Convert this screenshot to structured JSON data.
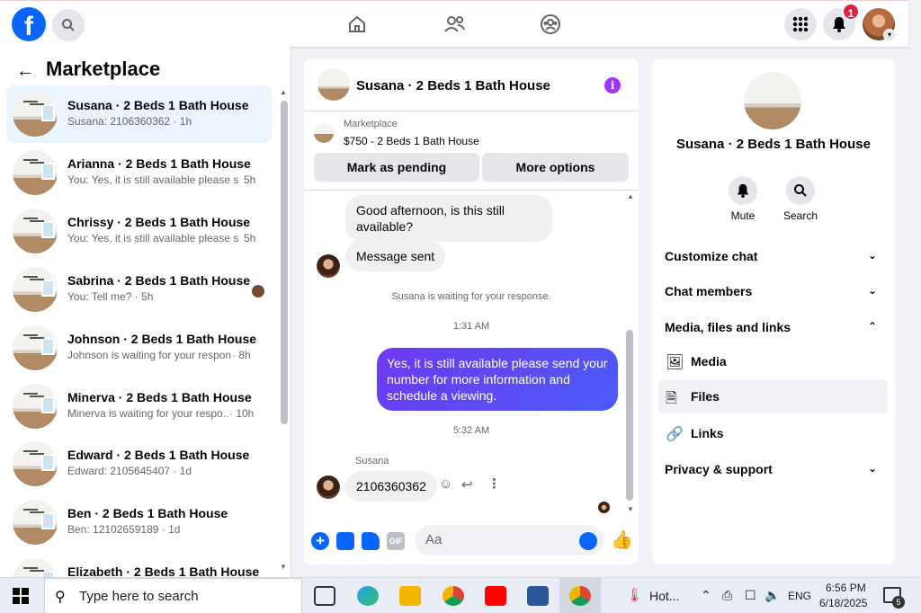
{
  "topbar": {
    "logo": "f",
    "notification_count": "1"
  },
  "left": {
    "title": "Marketplace",
    "conversations": [
      {
        "name": "Susana · 2 Beds 1 Bath House",
        "preview": "Susana: 2106360362 · 1h",
        "time": ""
      },
      {
        "name": "Arianna · 2 Beds 1 Bath House",
        "preview": "You: Yes, it is still available please s...",
        "time": "5h"
      },
      {
        "name": "Chrissy · 2 Beds 1 Bath House",
        "preview": "You: Yes, it is still available please s...",
        "time": "5h"
      },
      {
        "name": "Sabrina · 2 Beds 1 Bath House",
        "preview": "You: Tell me? · 5h",
        "time": ""
      },
      {
        "name": "Johnson · 2 Beds 1 Bath House",
        "preview": "Johnson is waiting for your respon...",
        "time": "· 8h"
      },
      {
        "name": "Minerva · 2 Beds 1 Bath House",
        "preview": "Minerva is waiting for your respo...",
        "time": "· 10h"
      },
      {
        "name": "Edward · 2 Beds 1 Bath House",
        "preview": "Edward: 2105645407 · 1d",
        "time": ""
      },
      {
        "name": "Ben · 2 Beds 1 Bath House",
        "preview": "Ben: 12102659189 · 1d",
        "time": ""
      },
      {
        "name": "Elizabeth · 2 Beds 1 Bath House",
        "preview": "",
        "time": ""
      }
    ]
  },
  "chat": {
    "title": "Susana · 2 Beds 1 Bath House",
    "marketplace_label": "Marketplace",
    "listing": "$750 - 2 Beds 1 Bath House",
    "btn_pending": "Mark as pending",
    "btn_more": "More options",
    "msg1": "Good afternoon, is this still available?",
    "msg2": "Message sent",
    "system": "Susana is waiting for your response.",
    "time1": "1:31 AM",
    "msg3": "Yes, it is still available please send your number for more information and schedule a viewing.",
    "time2": "5:32 AM",
    "sender": "Susana",
    "msg4": "2106360362",
    "composer_placeholder": "Aa"
  },
  "right": {
    "title": "Susana · 2 Beds 1 Bath House",
    "mute": "Mute",
    "search": "Search",
    "customize": "Customize chat",
    "members": "Chat members",
    "media_files": "Media, files and links",
    "media": "Media",
    "files": "Files",
    "links": "Links",
    "privacy": "Privacy & support"
  },
  "taskbar": {
    "search": "Type here to search",
    "weather": "Hot...",
    "lang": "ENG",
    "time": "6:56 PM",
    "date": "6/18/2025",
    "notif": "5"
  }
}
